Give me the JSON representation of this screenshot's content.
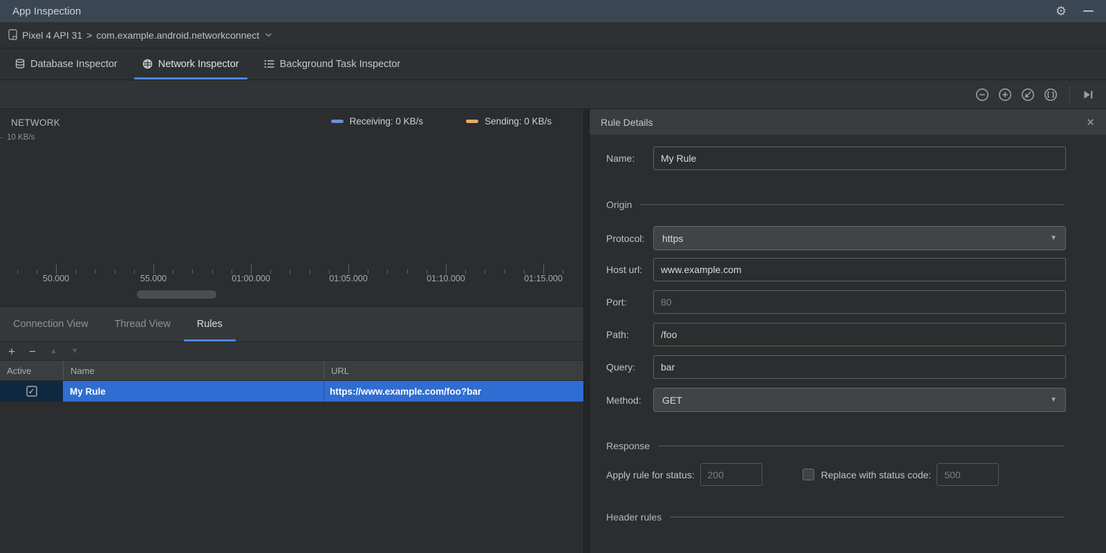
{
  "window": {
    "title": "App Inspection"
  },
  "title_bar_icons": {
    "gear": "⚙",
    "minimize": ""
  },
  "device_bar": {
    "device": "Pixel 4 API 31",
    "separator": ">",
    "process": "com.example.android.networkconnect"
  },
  "inspector_tabs": [
    {
      "label": "Database Inspector",
      "selected": false
    },
    {
      "label": "Network Inspector",
      "selected": true
    },
    {
      "label": "Background Task Inspector",
      "selected": false
    }
  ],
  "main_toolbar": {
    "icons": [
      "zoom-out",
      "zoom-in",
      "reset-zoom",
      "zoom-to-selection",
      "jump-to-live"
    ]
  },
  "network_chart": {
    "title": "NETWORK",
    "y_axis_label": "10 KB/s",
    "legends": [
      {
        "label": "Receiving: 0 KB/s",
        "color": "#6b8fd6"
      },
      {
        "label": "Sending: 0 KB/s",
        "color": "#eaa96e"
      }
    ],
    "timeline_ticks": [
      "50.000",
      "55.000",
      "01:00.000",
      "01:05.000",
      "01:10.000",
      "01:15.000"
    ]
  },
  "view_tabs": [
    {
      "label": "Connection View",
      "selected": false
    },
    {
      "label": "Thread View",
      "selected": false
    },
    {
      "label": "Rules",
      "selected": true
    }
  ],
  "rules_toolbar": {
    "add": "+",
    "remove": "−",
    "move_up": "▲",
    "move_down": "▼"
  },
  "rules_table": {
    "columns": [
      "Active",
      "Name",
      "URL"
    ],
    "rows": [
      {
        "active": true,
        "check_glyph": "✓",
        "name": "My Rule",
        "url": "https://www.example.com/foo?bar"
      }
    ]
  },
  "rule_details": {
    "title": "Rule Details",
    "close_glyph": "✕",
    "name_label": "Name:",
    "name_value": "My Rule",
    "sections": {
      "origin": "Origin",
      "response": "Response",
      "header_rules": "Header rules"
    },
    "origin_fields": [
      {
        "label": "Protocol:",
        "value": "https",
        "type": "combo"
      },
      {
        "label": "Host url:",
        "value": "www.example.com",
        "type": "text"
      },
      {
        "label": "Port:",
        "placeholder": "80",
        "type": "text"
      },
      {
        "label": "Path:",
        "value": "/foo",
        "type": "text"
      },
      {
        "label": "Query:",
        "value": "bar",
        "type": "text"
      },
      {
        "label": "Method:",
        "value": "GET",
        "type": "combo"
      }
    ],
    "response": {
      "apply_label": "Apply rule for status:",
      "apply_placeholder": "200",
      "replace_checkbox_checked": false,
      "replace_label": "Replace with status code:",
      "replace_placeholder": "500"
    }
  },
  "colors": {
    "selection_blue": "#2f6dd2",
    "tab_underline": "#4a88e8",
    "title_bar": "#3a4653"
  }
}
